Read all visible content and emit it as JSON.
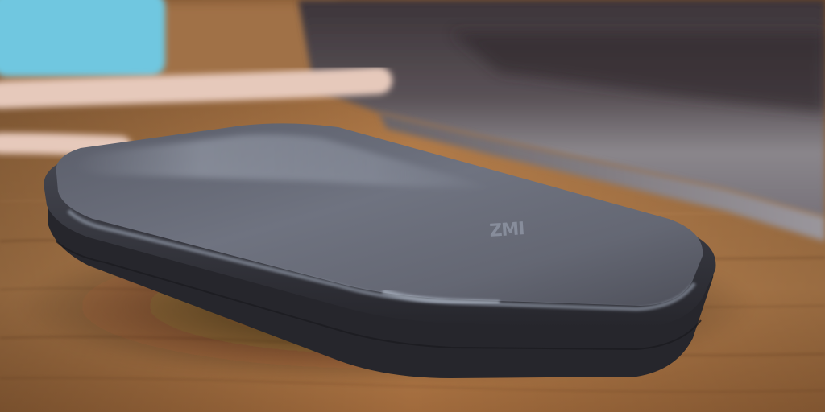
{
  "scene": {
    "objects": [
      {
        "name": "power-bank",
        "logo_text": "ZMI"
      },
      {
        "name": "laptop"
      },
      {
        "name": "usb-cable"
      },
      {
        "name": "blue-object"
      },
      {
        "name": "wooden-desk"
      }
    ],
    "colors": {
      "desk_light": "#c08752",
      "desk_mid": "#9a6a40",
      "desk_dark": "#5c3c22",
      "powerbank_top": "#6b6e7a",
      "powerbank_highlight": "#9da3b0",
      "powerbank_side": "#3d3e46",
      "powerbank_base": "#2a2a31",
      "laptop_body": "#7f7c82",
      "laptop_dark": "#3b3338",
      "cable": "#e6c9bb",
      "blue_object": "#6fc7e0"
    }
  }
}
